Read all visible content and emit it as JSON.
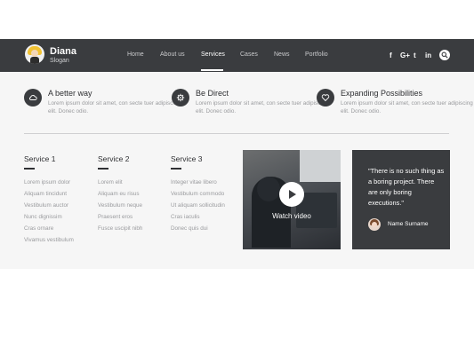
{
  "header": {
    "brand": {
      "name": "Diana",
      "slogan": "Slogan"
    },
    "nav": [
      {
        "label": "Home"
      },
      {
        "label": "About us"
      },
      {
        "label": "Services",
        "active": true
      },
      {
        "label": "Cases"
      },
      {
        "label": "News"
      },
      {
        "label": "Portfolio"
      }
    ],
    "social": [
      {
        "icon": "facebook-icon",
        "glyph": "f"
      },
      {
        "icon": "google-plus-icon",
        "glyph": "G+"
      },
      {
        "icon": "twitter-icon",
        "glyph": "t"
      },
      {
        "icon": "linkedin-icon",
        "glyph": "in"
      }
    ],
    "search_icon": "search-icon"
  },
  "features": [
    {
      "icon": "cloud-icon",
      "title": "A better way",
      "text": "Lorem ipsum dolor sit amet, con secte tuer adipiscing elit. Donec odio."
    },
    {
      "icon": "settings-icon",
      "title": "Be Direct",
      "text": "Lorem ipsum dolor sit amet, con secte tuer adipiscing elit. Donec odio."
    },
    {
      "icon": "heart-icon",
      "title": "Expanding Possibilities",
      "text": "Lorem ipsum dolor sit amet, con secte tuer adipiscing elit. Donec odio."
    }
  ],
  "services": [
    {
      "title": "Service 1",
      "items": [
        "Lorem ipsum dolor",
        "Aliquam tincidunt",
        "Vestibulum auctor",
        "Nunc dignissim",
        "Cras ornare",
        "Vivamus vestibulum"
      ]
    },
    {
      "title": "Service 2",
      "items": [
        "Lorem elit",
        "Aliquam eu risus",
        "Vestibulum neque",
        "Praesent eros",
        "Fusce uscipit nibh"
      ]
    },
    {
      "title": "Service 3",
      "items": [
        "Integer vitae libero",
        "Vestibulum commodo",
        "Ut aliquam sollicitudin",
        "Cras iaculis",
        "Donec quis dui"
      ]
    }
  ],
  "video": {
    "label": "Watch video"
  },
  "testimonial": {
    "quote": "\"There is no such thing as a boring project. There are only boring executions.\"",
    "name": "Name Surname"
  },
  "colors": {
    "dark": "#3a3c3f",
    "background": "#f6f6f6",
    "muted_text": "#9a9b9e"
  }
}
